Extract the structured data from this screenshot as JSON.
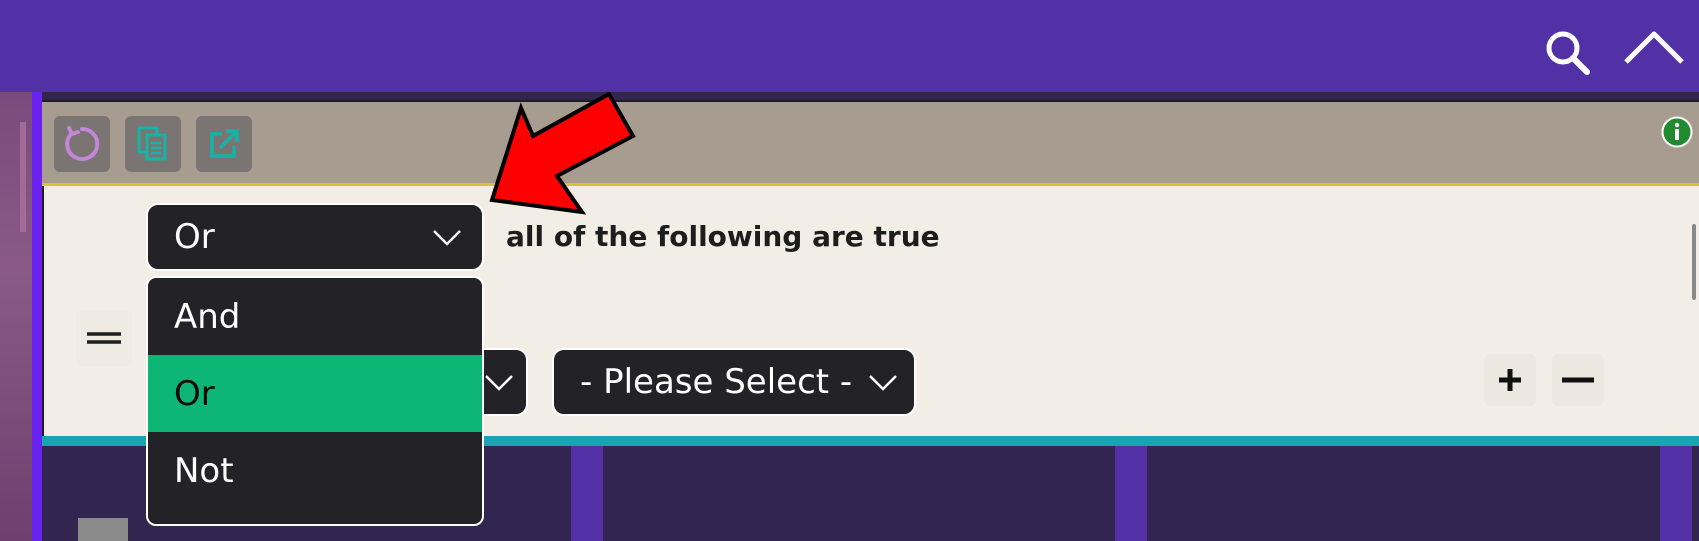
{
  "topbar": {
    "search_icon": "search-icon",
    "collapse_icon": "chevron-up-icon"
  },
  "toolbar": {
    "buttons": [
      {
        "icon": "refresh-icon",
        "color": "#c386d8"
      },
      {
        "icon": "copy-icon",
        "color": "#14b5a8"
      },
      {
        "icon": "open-external-icon",
        "color": "#14b5a8"
      }
    ],
    "info_icon": "info-icon",
    "info_color": "#1f8a2e"
  },
  "condition": {
    "operator_selected": "Or",
    "text": "all of the following are true"
  },
  "operator_menu": {
    "options": [
      "And",
      "Or",
      "Not"
    ],
    "selected": "Or"
  },
  "rule": {
    "value_select": "- Please Select -",
    "add_icon": "plus-icon",
    "remove_icon": "minus-icon"
  },
  "colors": {
    "header": "#5230a5",
    "toolbar": "#a69c8f",
    "editor": "#f2eee6",
    "selected": "#0db674",
    "dark": "#232227",
    "accent_bar": "#1aa3b0",
    "annotation_arrow": "#ff0000"
  }
}
